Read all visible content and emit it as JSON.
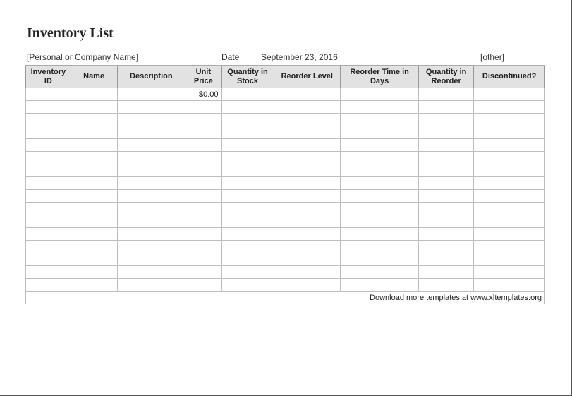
{
  "title": "Inventory List",
  "meta": {
    "company_placeholder": "[Personal or Company Name]",
    "date_label": "Date",
    "date_value": "September 23, 2016",
    "other_placeholder": "[other]"
  },
  "columns": [
    "Inventory ID",
    "Name",
    "Description",
    "Unit Price",
    "Quantity in Stock",
    "Reorder Level",
    "Reorder Time in Days",
    "Quantity in Reorder",
    "Discontinued?"
  ],
  "rows": [
    {
      "inventory_id": "",
      "name": "",
      "description": "",
      "unit_price": "$0.00",
      "qty_in_stock": "",
      "reorder_level": "",
      "reorder_time_days": "",
      "qty_in_reorder": "",
      "discontinued": ""
    },
    {
      "inventory_id": "",
      "name": "",
      "description": "",
      "unit_price": "",
      "qty_in_stock": "",
      "reorder_level": "",
      "reorder_time_days": "",
      "qty_in_reorder": "",
      "discontinued": ""
    },
    {
      "inventory_id": "",
      "name": "",
      "description": "",
      "unit_price": "",
      "qty_in_stock": "",
      "reorder_level": "",
      "reorder_time_days": "",
      "qty_in_reorder": "",
      "discontinued": ""
    },
    {
      "inventory_id": "",
      "name": "",
      "description": "",
      "unit_price": "",
      "qty_in_stock": "",
      "reorder_level": "",
      "reorder_time_days": "",
      "qty_in_reorder": "",
      "discontinued": ""
    },
    {
      "inventory_id": "",
      "name": "",
      "description": "",
      "unit_price": "",
      "qty_in_stock": "",
      "reorder_level": "",
      "reorder_time_days": "",
      "qty_in_reorder": "",
      "discontinued": ""
    },
    {
      "inventory_id": "",
      "name": "",
      "description": "",
      "unit_price": "",
      "qty_in_stock": "",
      "reorder_level": "",
      "reorder_time_days": "",
      "qty_in_reorder": "",
      "discontinued": ""
    },
    {
      "inventory_id": "",
      "name": "",
      "description": "",
      "unit_price": "",
      "qty_in_stock": "",
      "reorder_level": "",
      "reorder_time_days": "",
      "qty_in_reorder": "",
      "discontinued": ""
    },
    {
      "inventory_id": "",
      "name": "",
      "description": "",
      "unit_price": "",
      "qty_in_stock": "",
      "reorder_level": "",
      "reorder_time_days": "",
      "qty_in_reorder": "",
      "discontinued": ""
    },
    {
      "inventory_id": "",
      "name": "",
      "description": "",
      "unit_price": "",
      "qty_in_stock": "",
      "reorder_level": "",
      "reorder_time_days": "",
      "qty_in_reorder": "",
      "discontinued": ""
    },
    {
      "inventory_id": "",
      "name": "",
      "description": "",
      "unit_price": "",
      "qty_in_stock": "",
      "reorder_level": "",
      "reorder_time_days": "",
      "qty_in_reorder": "",
      "discontinued": ""
    },
    {
      "inventory_id": "",
      "name": "",
      "description": "",
      "unit_price": "",
      "qty_in_stock": "",
      "reorder_level": "",
      "reorder_time_days": "",
      "qty_in_reorder": "",
      "discontinued": ""
    },
    {
      "inventory_id": "",
      "name": "",
      "description": "",
      "unit_price": "",
      "qty_in_stock": "",
      "reorder_level": "",
      "reorder_time_days": "",
      "qty_in_reorder": "",
      "discontinued": ""
    },
    {
      "inventory_id": "",
      "name": "",
      "description": "",
      "unit_price": "",
      "qty_in_stock": "",
      "reorder_level": "",
      "reorder_time_days": "",
      "qty_in_reorder": "",
      "discontinued": ""
    },
    {
      "inventory_id": "",
      "name": "",
      "description": "",
      "unit_price": "",
      "qty_in_stock": "",
      "reorder_level": "",
      "reorder_time_days": "",
      "qty_in_reorder": "",
      "discontinued": ""
    },
    {
      "inventory_id": "",
      "name": "",
      "description": "",
      "unit_price": "",
      "qty_in_stock": "",
      "reorder_level": "",
      "reorder_time_days": "",
      "qty_in_reorder": "",
      "discontinued": ""
    },
    {
      "inventory_id": "",
      "name": "",
      "description": "",
      "unit_price": "",
      "qty_in_stock": "",
      "reorder_level": "",
      "reorder_time_days": "",
      "qty_in_reorder": "",
      "discontinued": ""
    }
  ],
  "footer_text": "Download more templates at www.xltemplates.org"
}
